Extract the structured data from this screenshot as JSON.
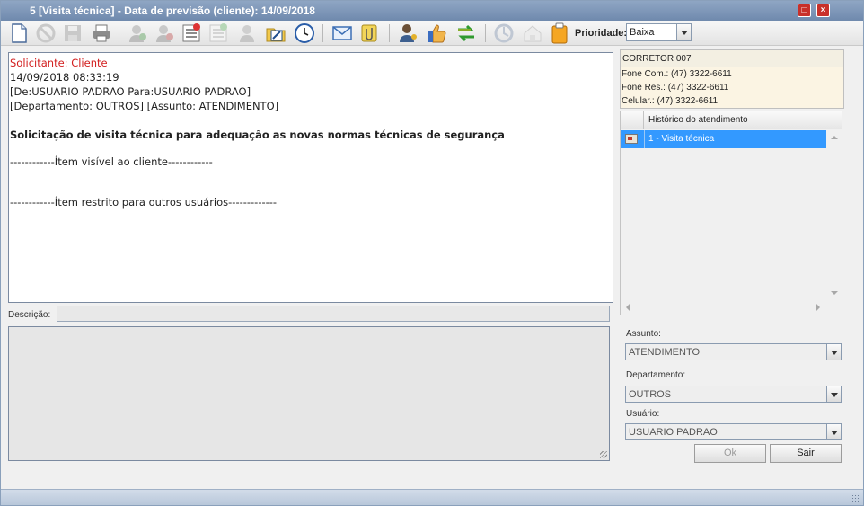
{
  "window": {
    "title": "5 [Visita técnica] - Data de previsão (cliente): 14/09/2018",
    "maximize_icon": "maximize-icon",
    "close_icon": "close-icon"
  },
  "toolbar": {
    "icons": [
      "new-document-icon",
      "cancel-icon",
      "save-icon",
      "print-icon",
      "user-green-icon",
      "user-red-icon",
      "email-list-icon",
      "email-list-disabled-icon",
      "user-disabled-icon",
      "edit-folder-icon",
      "clock-icon",
      "mail-icon",
      "attachment-icon",
      "user-key-icon",
      "thumbs-up-icon",
      "transfer-arrows-icon",
      "refresh-disabled-icon",
      "home-disabled-icon",
      "clipboard-icon"
    ],
    "priority_label": "Prioridade:",
    "priority_value": "Baixa"
  },
  "message": {
    "requester": "Solicitante: Cliente",
    "datetime": "14/09/2018 08:33:19",
    "from_to": "[De:USUARIO PADRAO Para:USUARIO PADRAO]",
    "dept_subject": "[Departamento: OUTROS] [Assunto: ATENDIMENTO]",
    "headline": "Solicitação de visita técnica para adequação as novas normas técnicas de segurança",
    "visible_section": "------------Ítem visível ao cliente------------",
    "restricted_section": "------------Ítem restrito para outros usuários-------------"
  },
  "description": {
    "label": "Descrição:",
    "value": ""
  },
  "contact": {
    "name": "CORRETOR 007",
    "phone_com": "Fone Com.: (47) 3322-6611",
    "phone_res": "Fone Res.: (47) 3322-6611",
    "mobile": "Celular.: (47) 3322-6611"
  },
  "history": {
    "header": "Histórico do atendimento",
    "rows": [
      {
        "label": "1 - Visita técnica"
      }
    ]
  },
  "form": {
    "subject_label": "Assunto:",
    "subject_value": "ATENDIMENTO",
    "department_label": "Departamento:",
    "department_value": "OUTROS",
    "user_label": "Usuário:",
    "user_value": "USUARIO PADRAO"
  },
  "buttons": {
    "ok": "Ok",
    "exit": "Sair"
  },
  "colors": {
    "title_bar": "#7b93b5",
    "requester_text": "#d21d1d",
    "selected_row": "#3399ff",
    "contact_panel": "#fbf4e3"
  }
}
